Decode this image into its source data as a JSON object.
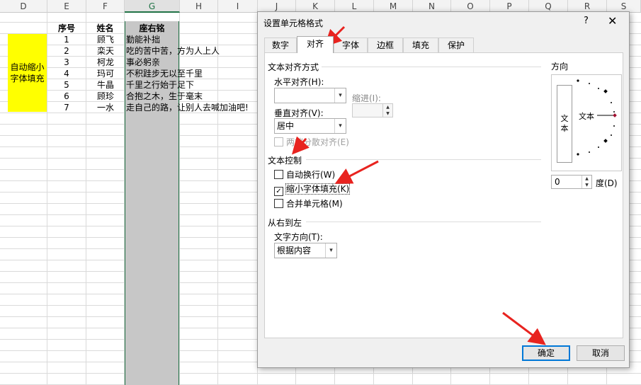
{
  "columns": [
    "D",
    "E",
    "F",
    "G",
    "H",
    "I",
    "J",
    "K",
    "L",
    "M",
    "N",
    "O",
    "P",
    "Q",
    "R",
    "S"
  ],
  "table": {
    "headers": {
      "seq": "序号",
      "name": "姓名",
      "motto": "座右铭"
    },
    "rows": [
      {
        "seq": "1",
        "name": "顾飞",
        "motto": "勤能补拙"
      },
      {
        "seq": "2",
        "name": "栾天",
        "motto": "吃的苦中苦，方为人上人"
      },
      {
        "seq": "3",
        "name": "柯龙",
        "motto": "事必躬亲"
      },
      {
        "seq": "4",
        "name": "玛可",
        "motto": "不积跬步无以至千里"
      },
      {
        "seq": "5",
        "name": "牛晶",
        "motto": "千里之行始于足下"
      },
      {
        "seq": "6",
        "name": "顾珍",
        "motto": "合抱之木，生于毫末"
      },
      {
        "seq": "7",
        "name": "一水",
        "motto": "走自己的路，让别人去喊加油吧!"
      }
    ],
    "merged_cell_text": "自动缩小字体填充"
  },
  "dialog": {
    "title": "设置单元格格式",
    "help": "?",
    "close": "✕",
    "tabs": [
      "数字",
      "对齐",
      "字体",
      "边框",
      "填充",
      "保护"
    ],
    "active_tab": "对齐",
    "alignment": {
      "section_title": "文本对齐方式",
      "horizontal_label": "水平对齐(H):",
      "horizontal_value": "",
      "indent_label": "缩进(I):",
      "indent_value": "",
      "vertical_label": "垂直对齐(V):",
      "vertical_value": "居中",
      "distributed_label": "两端分散对齐(E)"
    },
    "text_control": {
      "section_title": "文本控制",
      "wrap_label": "自动换行(W)",
      "wrap_checked": false,
      "shrink_label": "缩小字体填充(K)",
      "shrink_checked": true,
      "merge_label": "合并单元格(M)",
      "merge_checked": false
    },
    "rtl": {
      "section_title": "从右到左",
      "direction_label": "文字方向(T):",
      "direction_value": "根据内容"
    },
    "orientation": {
      "section_title": "方向",
      "vertical_text": "文本",
      "dial_text": "文本",
      "degree_value": "0",
      "degree_label": "度(D)"
    },
    "ok_label": "确定",
    "cancel_label": "取消"
  },
  "colors": {
    "accent": "#217346",
    "highlight": "#ffff00",
    "arrow": "#e8231f",
    "focus": "#0078d7"
  }
}
